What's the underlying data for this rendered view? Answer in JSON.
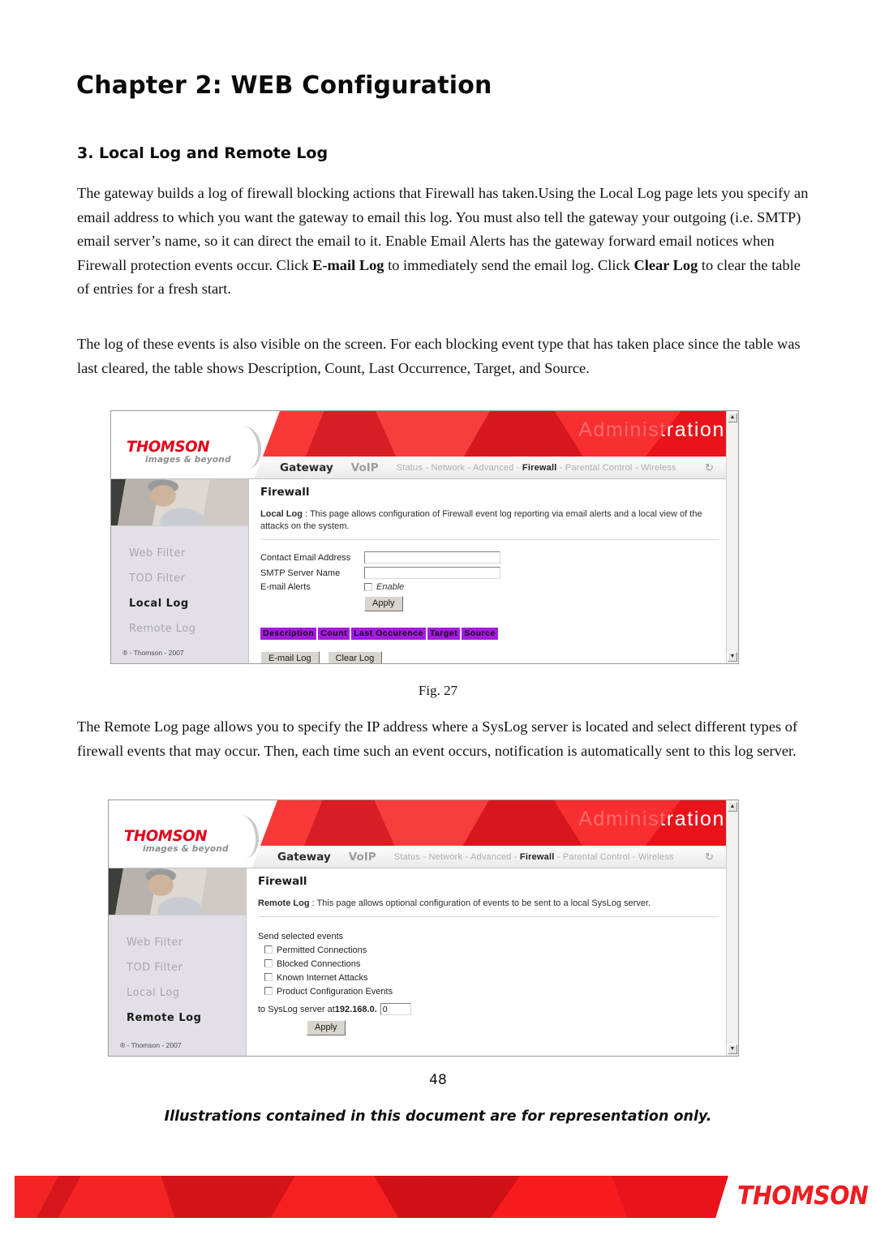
{
  "document": {
    "chapter_title": "Chapter 2: WEB Configuration",
    "section_title": "3. Local Log and Remote Log",
    "paragraph_1_part_a": "The gateway builds a log of firewall blocking actions that Firewall has taken.Using the Local Log page lets you specify an email address to which you want the gateway to email this log. You must also tell the gateway your outgoing (i.e. SMTP) email server’s name, so it can direct the email to it. Enable Email Alerts has the gateway forward email notices when Firewall protection events occur. Click ",
    "paragraph_1_bold_1": "E-mail Log",
    "paragraph_1_part_b": " to immediately send the email log. Click ",
    "paragraph_1_bold_2": "Clear Log",
    "paragraph_1_part_c": " to clear the table of entries for a fresh start.",
    "paragraph_2": "The log of these events is also visible on the screen. For each blocking event type that has taken place since the table was last cleared, the table shows Description, Count, Last Occurrence, Target, and Source.",
    "figure_caption": "Fig. 27",
    "paragraph_3": "The Remote Log page allows you to specify the IP address where a SysLog server is located and select different types of firewall events that may occur. Then, each time such an event occurs, notification is automatically sent to this log server.",
    "page_number": "48",
    "disclaimer": "Illustrations contained in this document are for representation only.",
    "footer_brand": "THOMSON",
    "accent_red": "#e8131b"
  },
  "screenshot_local_log": {
    "brand": {
      "name": "THOMSON",
      "tagline": "images & beyond"
    },
    "masthead_title": "Administration",
    "nav": {
      "primary": [
        {
          "label": "Gateway",
          "active": true
        },
        {
          "label": "VoIP",
          "active": false
        }
      ],
      "secondary": [
        {
          "label": "Status",
          "selected": false
        },
        {
          "label": "Network",
          "selected": false
        },
        {
          "label": "Advanced",
          "selected": false
        },
        {
          "label": "Firewall",
          "selected": true
        },
        {
          "label": "Parental Control",
          "selected": false
        },
        {
          "label": "Wireless",
          "selected": false
        }
      ],
      "separator": "-",
      "refresh_icon": "refresh-icon"
    },
    "sidebar": {
      "items": [
        {
          "label": "Web Filter",
          "active": false
        },
        {
          "label": "TOD Filter",
          "active": false
        },
        {
          "label": "Local Log",
          "active": true
        },
        {
          "label": "Remote Log",
          "active": false
        }
      ],
      "copyright": "® - Thomson - 2007"
    },
    "content": {
      "title": "Firewall",
      "desc_bold": "Local Log",
      "desc_sep": " : ",
      "desc_text": "This page allows configuration of Firewall event log reporting via email alerts and a local view of the attacks on the system.",
      "fields": [
        {
          "label": "Contact Email Address",
          "value": "",
          "type": "text"
        },
        {
          "label": "SMTP Server Name",
          "value": "",
          "type": "text"
        }
      ],
      "email_alerts_label": "E-mail Alerts",
      "email_alerts_checkbox_label": "Enable",
      "email_alerts_checked": false,
      "apply_label": "Apply",
      "table_headers": [
        "Description",
        "Count",
        "Last Occurence",
        "Target",
        "Source"
      ],
      "table_header_bg": "#a51ae0",
      "log_buttons": [
        "E-mail Log",
        "Clear Log"
      ]
    }
  },
  "screenshot_remote_log": {
    "brand": {
      "name": "THOMSON",
      "tagline": "images & beyond"
    },
    "masthead_title": "Administration",
    "nav": {
      "primary": [
        {
          "label": "Gateway",
          "active": true
        },
        {
          "label": "VoIP",
          "active": false
        }
      ],
      "secondary": [
        {
          "label": "Status",
          "selected": false
        },
        {
          "label": "Network",
          "selected": false
        },
        {
          "label": "Advanced",
          "selected": false
        },
        {
          "label": "Firewall",
          "selected": true
        },
        {
          "label": "Parental Control",
          "selected": false
        },
        {
          "label": "Wireless",
          "selected": false
        }
      ],
      "separator": "-",
      "refresh_icon": "refresh-icon"
    },
    "sidebar": {
      "items": [
        {
          "label": "Web Filter",
          "active": false
        },
        {
          "label": "TOD Filter",
          "active": false
        },
        {
          "label": "Local Log",
          "active": false
        },
        {
          "label": "Remote Log",
          "active": true
        }
      ],
      "copyright": "® - Thomson - 2007"
    },
    "content": {
      "title": "Firewall",
      "desc_bold": "Remote Log",
      "desc_sep": " : ",
      "desc_text": "This page allows optional configuration of events to be sent to a local SysLog server.",
      "events_label": "Send selected events",
      "events": [
        {
          "label": "Permitted Connections",
          "checked": false
        },
        {
          "label": "Blocked Connections",
          "checked": false
        },
        {
          "label": "Known Internet Attacks",
          "checked": false
        },
        {
          "label": "Product Configuration Events",
          "checked": false
        }
      ],
      "syslog_prefix": "to SysLog server at ",
      "syslog_base": "192.168.0.",
      "syslog_octet_value": "0",
      "apply_label": "Apply"
    }
  }
}
